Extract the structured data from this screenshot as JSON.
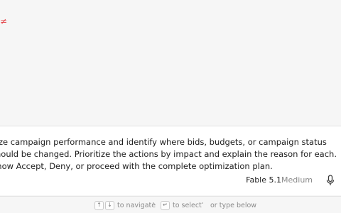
{
  "prompt": {
    "text": "lyze campaign performance and identify where bids, budgets, or campaign status should be changed. Prioritize the actions by impact and explain the reason for each. Show Accept, Deny, or proceed with the complete optimization plan."
  },
  "model": {
    "name": "Fable 5.1",
    "effort": "Medium"
  },
  "hints": {
    "navigate": "to navigate",
    "select": "to select",
    "type_below": "or type below"
  },
  "icons": {
    "up": "arrow-up-icon",
    "down": "arrow-down-icon",
    "enter": "enter-icon",
    "mic": "microphone-icon"
  },
  "colors": {
    "accent_red": "#e5484d",
    "muted": "#8a8a8a"
  }
}
